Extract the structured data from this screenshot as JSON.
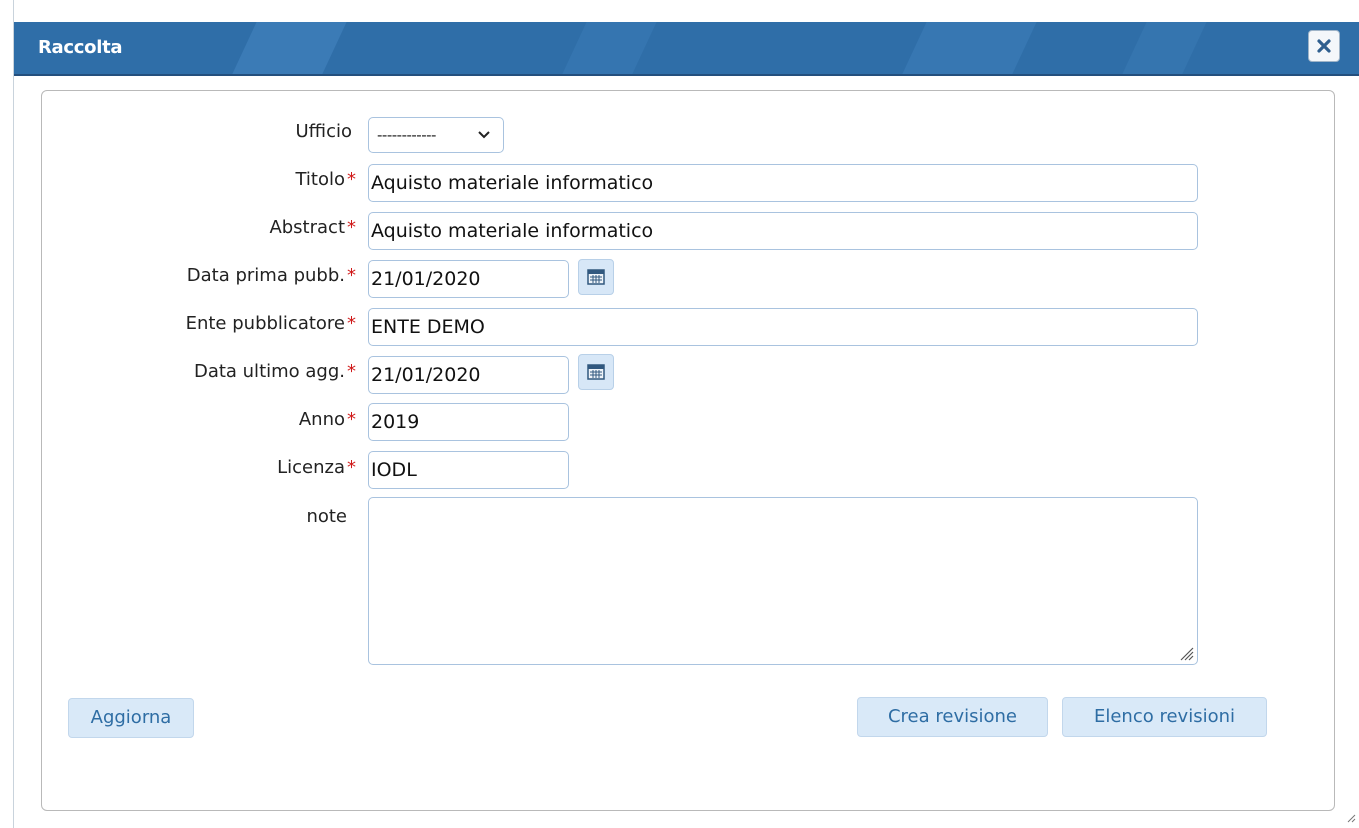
{
  "window": {
    "title": "Raccolta",
    "close_icon": "close-icon"
  },
  "form": {
    "ufficio": {
      "label": "Ufficio",
      "value": "------------"
    },
    "titolo": {
      "label": "Titolo",
      "required_mark": "*",
      "value": "Aquisto materiale informatico"
    },
    "abstract": {
      "label": "Abstract",
      "required_mark": "*",
      "value": "Aquisto materiale informatico"
    },
    "data_prima_pubb": {
      "label": "Data prima pubb.",
      "required_mark": "*",
      "value": "21/01/2020"
    },
    "ente_pubblicatore": {
      "label": "Ente pubblicatore",
      "required_mark": "*",
      "value": "ENTE DEMO"
    },
    "data_ultimo_agg": {
      "label": "Data ultimo agg.",
      "required_mark": "*",
      "value": "21/01/2020"
    },
    "anno": {
      "label": "Anno",
      "required_mark": "*",
      "value": "2019"
    },
    "licenza": {
      "label": "Licenza",
      "required_mark": "*",
      "value": "IODL"
    },
    "note": {
      "label": "note",
      "value": ""
    }
  },
  "buttons": {
    "aggiorna": "Aggiorna",
    "crea_revisione": "Crea revisione",
    "elenco_revisioni": "Elenco revisioni"
  },
  "colors": {
    "titlebar": "#2f6ea8",
    "required": "#d01a1a",
    "button_bg": "#d9e9f8",
    "button_text": "#2e6da4",
    "field_border": "#a9c3df"
  }
}
